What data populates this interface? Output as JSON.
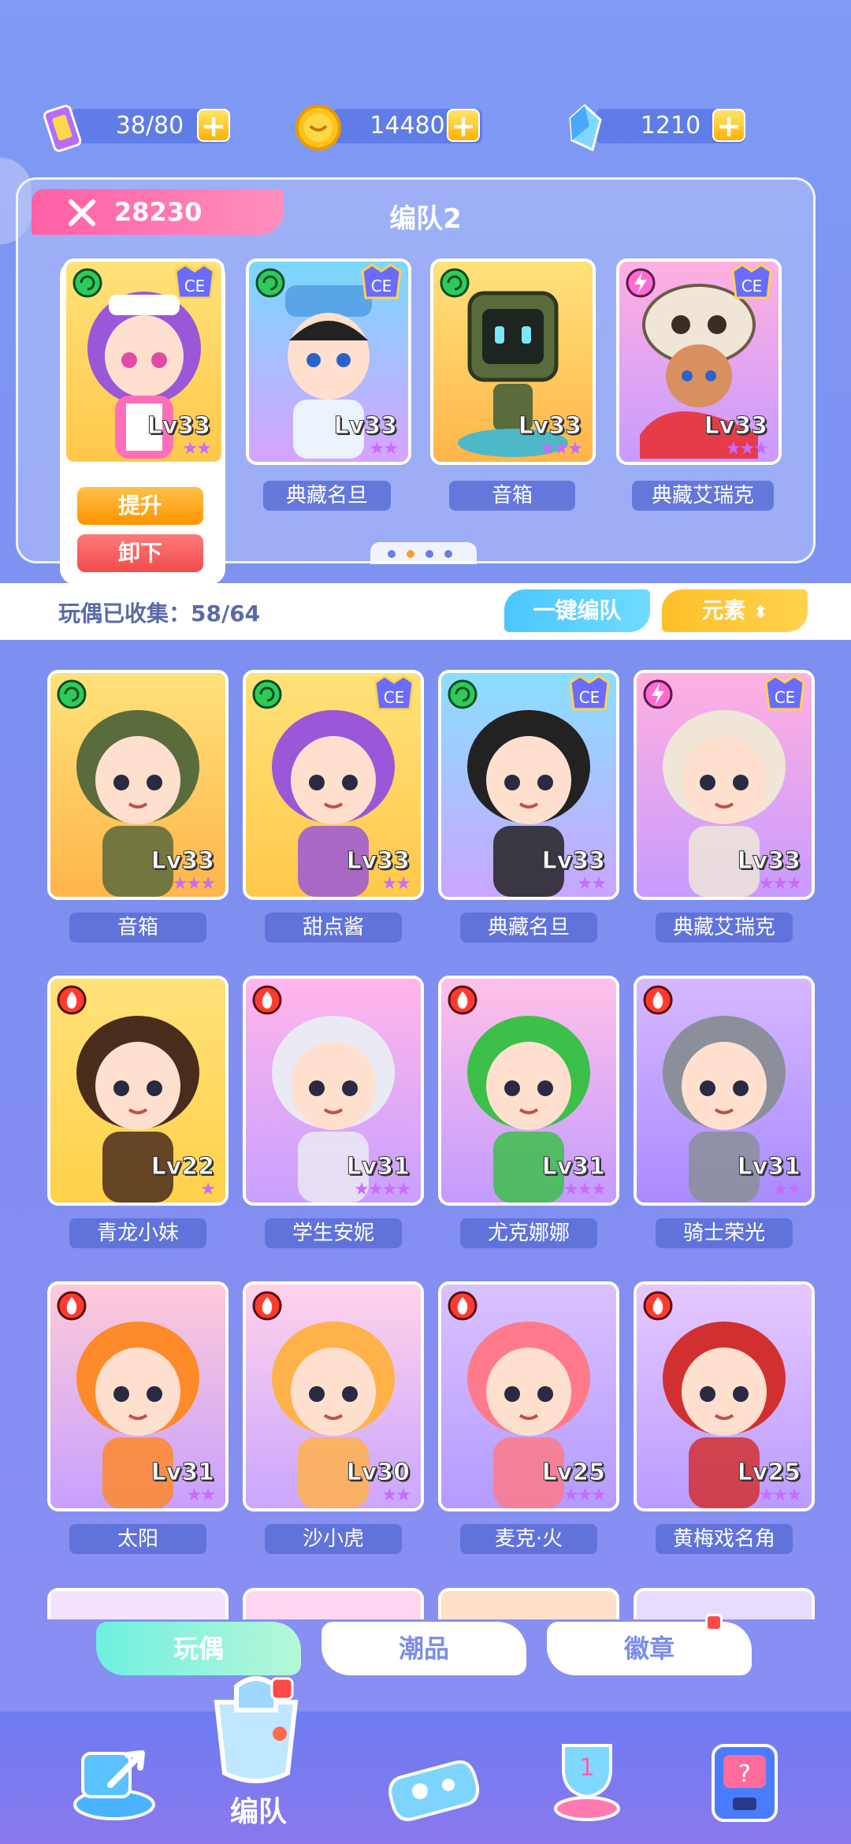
{
  "resources": {
    "stamina": "38/80",
    "coins": "14480",
    "gems": "1210",
    "add_label": "+"
  },
  "team": {
    "power": "28230",
    "title": "编队2",
    "slots": [
      {
        "name": "",
        "level": "Lv33",
        "stars": "★★"
      },
      {
        "name": "典藏名旦",
        "level": "Lv33",
        "stars": "★★"
      },
      {
        "name": "音箱",
        "level": "Lv33",
        "stars": "★★★"
      },
      {
        "name": "典藏艾瑞克",
        "level": "Lv33",
        "stars": "★★★"
      }
    ],
    "upgrade_label": "提升",
    "unload_label": "卸下"
  },
  "collection": {
    "collected_text": "玩偶已收集：58/64",
    "one_key_label": "一键编队",
    "element_sort_label": "元素"
  },
  "dolls": [
    {
      "name": "音箱",
      "level": "Lv33",
      "stars": "★★★"
    },
    {
      "name": "甜点酱",
      "level": "Lv33",
      "stars": "★★"
    },
    {
      "name": "典藏名旦",
      "level": "Lv33",
      "stars": "★★"
    },
    {
      "name": "典藏艾瑞克",
      "level": "Lv33",
      "stars": "★★★"
    },
    {
      "name": "青龙小妹",
      "level": "Lv22",
      "stars": "★"
    },
    {
      "name": "学生安妮",
      "level": "Lv31",
      "stars": "★★★★"
    },
    {
      "name": "尤克娜娜",
      "level": "Lv31",
      "stars": "★★★"
    },
    {
      "name": "骑士荣光",
      "level": "Lv31",
      "stars": "★★"
    },
    {
      "name": "太阳",
      "level": "Lv31",
      "stars": "★★"
    },
    {
      "name": "沙小虎",
      "level": "Lv30",
      "stars": "★★"
    },
    {
      "name": "麦克·火",
      "level": "Lv25",
      "stars": "★★★"
    },
    {
      "name": "黄梅戏名角",
      "level": "Lv25",
      "stars": "★★★"
    }
  ],
  "sub_tabs": {
    "dolls": "玩偶",
    "trendy": "潮品",
    "badges": "徽章"
  },
  "nav": {
    "active_label": "编队"
  },
  "colors": {
    "accent_pink": "#ff5fa5",
    "accent_yellow": "#ffbf29",
    "accent_blue": "#4bc6ff"
  }
}
